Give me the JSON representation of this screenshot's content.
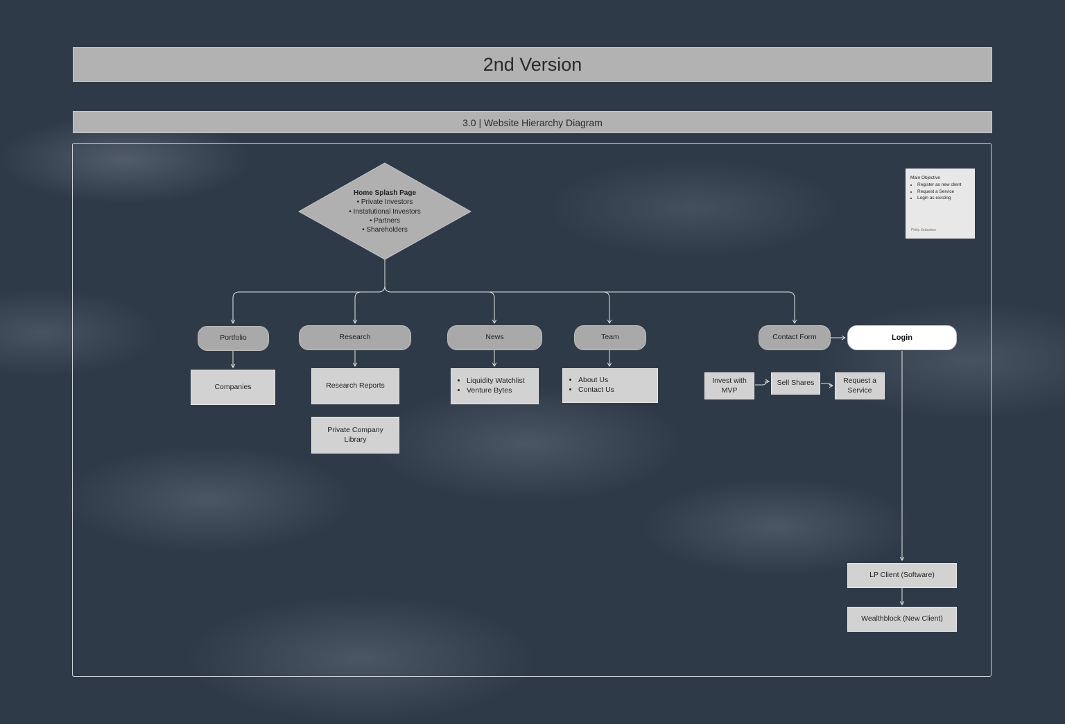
{
  "header": {
    "title": "2nd Version",
    "subtitle": "3.0 | Website Hierarchy Diagram"
  },
  "diagram": {
    "root": {
      "title": "Home Splash Page",
      "items": [
        "Private Investors",
        "Instatutional Investors",
        "Partners",
        "Shareholders"
      ]
    },
    "sections": {
      "portfolio": "Portfolio",
      "research": "Research",
      "news": "News",
      "team": "Team",
      "contact_form": "Contact Form",
      "login": "Login"
    },
    "children": {
      "companies": "Companies",
      "research_reports": "Research Reports",
      "private_company_library": "Private Company Library",
      "news_items": [
        "Liquidity Watchlist",
        "Venture Bytes"
      ],
      "team_items": [
        "About Us",
        "Contact Us"
      ],
      "invest_with_mvp": "Invest with MVP",
      "sell_shares": "Sell Shares",
      "request_service": "Request a Service",
      "lp_client": "LP Client (Software)",
      "wealthblock": "Wealthblock (New Client)"
    },
    "colors": {
      "background": "#2f3a48",
      "node_pill": "#a9a9a9",
      "node_box": "#d2d2d2",
      "connector": "#e6e6e6",
      "login_node": "#ffffff"
    }
  },
  "sticky_note": {
    "title": "Main Objective",
    "items": [
      "Register as new client",
      "Request a Service",
      "Login as existing"
    ],
    "author": "Philip Sebastian"
  }
}
